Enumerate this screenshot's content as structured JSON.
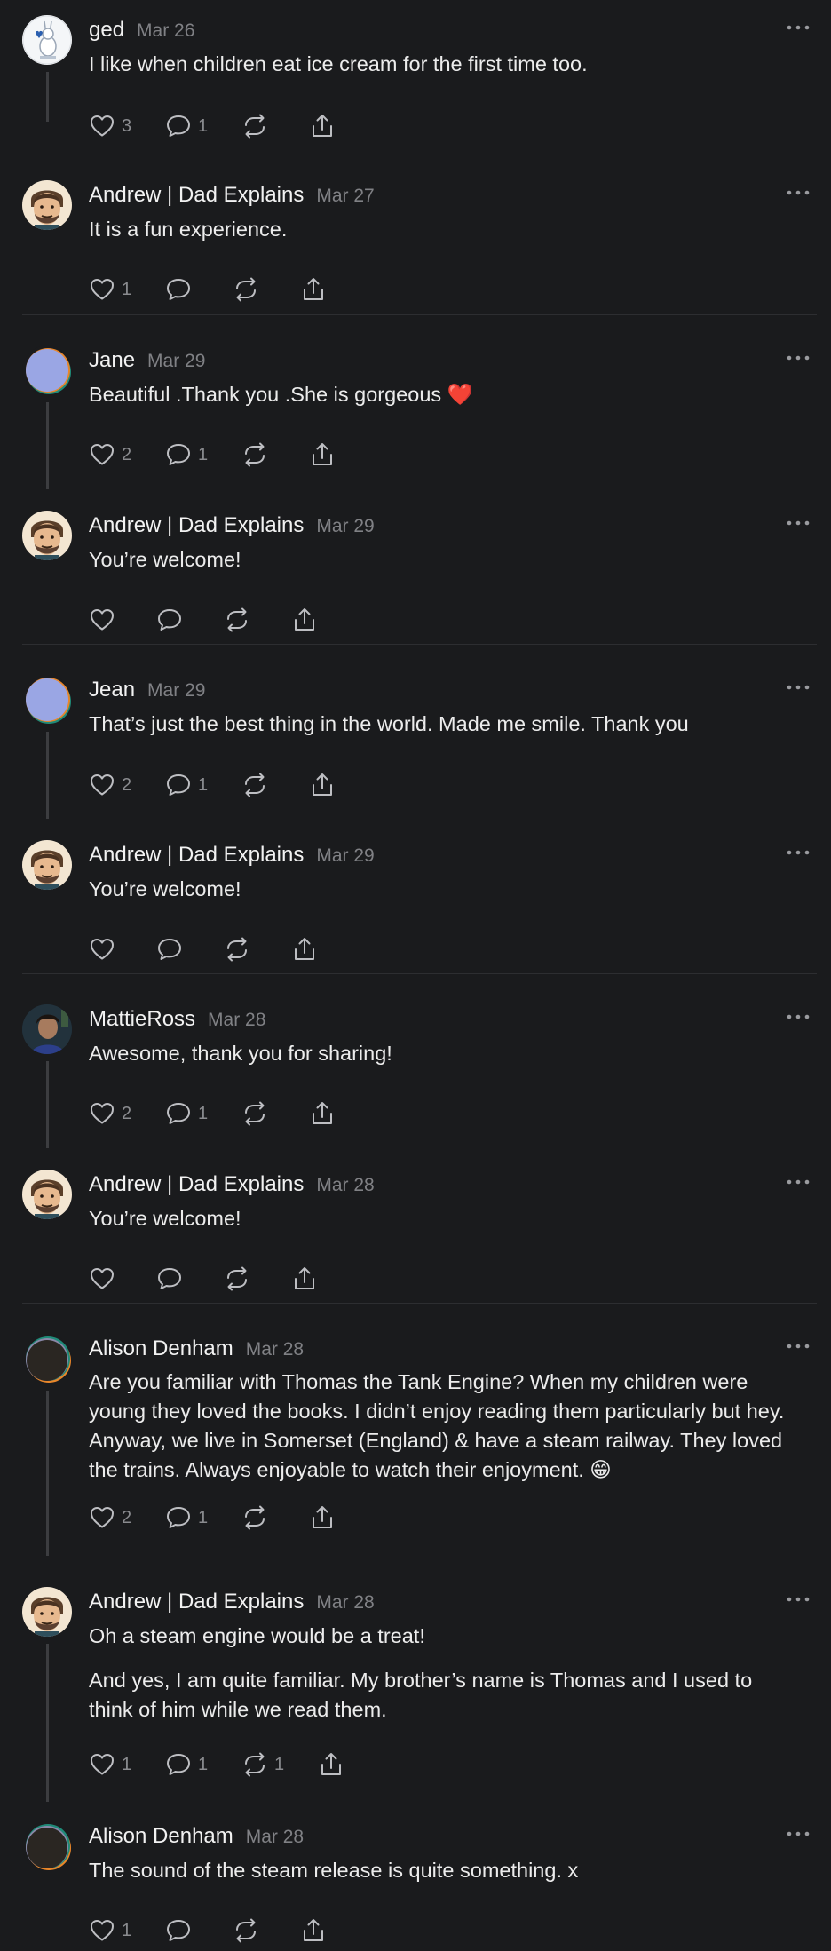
{
  "comments": [
    {
      "author": "ged",
      "date": "Mar 26",
      "avatar": "ged-avatar",
      "text": [
        "I like when children eat ice cream for the first time too."
      ],
      "likes": "3",
      "replies": "1",
      "reposts": ""
    },
    {
      "author": "Andrew | Dad Explains",
      "date": "Mar 27",
      "avatar": "andrew-avatar",
      "text": [
        "It is a fun experience."
      ],
      "likes": "1",
      "replies": "",
      "reposts": ""
    },
    {
      "author": "Jane",
      "date": "Mar 29",
      "avatar": "default-avatar",
      "text": [
        "Beautiful .Thank you .She is gorgeous ❤️"
      ],
      "likes": "2",
      "replies": "1",
      "reposts": ""
    },
    {
      "author": "Andrew | Dad Explains",
      "date": "Mar 29",
      "avatar": "andrew-avatar",
      "text": [
        "You’re welcome!"
      ],
      "likes": "",
      "replies": "",
      "reposts": ""
    },
    {
      "author": "Jean",
      "date": "Mar 29",
      "avatar": "default-avatar",
      "text": [
        "That’s just the best thing in the world. Made me smile. Thank you"
      ],
      "likes": "2",
      "replies": "1",
      "reposts": ""
    },
    {
      "author": "Andrew | Dad Explains",
      "date": "Mar 29",
      "avatar": "andrew-avatar",
      "text": [
        "You’re welcome!"
      ],
      "likes": "",
      "replies": "",
      "reposts": ""
    },
    {
      "author": "MattieRoss",
      "date": "Mar 28",
      "avatar": "photo-avatar",
      "text": [
        "Awesome, thank you for sharing!"
      ],
      "likes": "2",
      "replies": "1",
      "reposts": ""
    },
    {
      "author": "Andrew | Dad Explains",
      "date": "Mar 28",
      "avatar": "andrew-avatar",
      "text": [
        "You’re welcome!"
      ],
      "likes": "",
      "replies": "",
      "reposts": ""
    },
    {
      "author": "Alison Denham",
      "date": "Mar 28",
      "avatar": "dark-avatar",
      "text": [
        "Are you familiar with Thomas the Tank Engine? When my children were young they loved the books. I didn’t enjoy reading them particularly but hey. Anyway, we live in Somerset (England) & have a steam railway. They loved the trains. Always enjoyable to watch their enjoyment. 😁"
      ],
      "likes": "2",
      "replies": "1",
      "reposts": ""
    },
    {
      "author": "Andrew | Dad Explains",
      "date": "Mar 28",
      "avatar": "andrew-avatar",
      "text": [
        "Oh a steam engine would be a treat!",
        "And yes, I am quite familiar. My brother’s name is Thomas and I used to think of him while we read them."
      ],
      "likes": "1",
      "replies": "1",
      "reposts": "1"
    },
    {
      "author": "Alison Denham",
      "date": "Mar 28",
      "avatar": "dark-avatar",
      "text": [
        "The sound of the steam release is quite something. x"
      ],
      "likes": "1",
      "replies": "",
      "reposts": ""
    }
  ]
}
